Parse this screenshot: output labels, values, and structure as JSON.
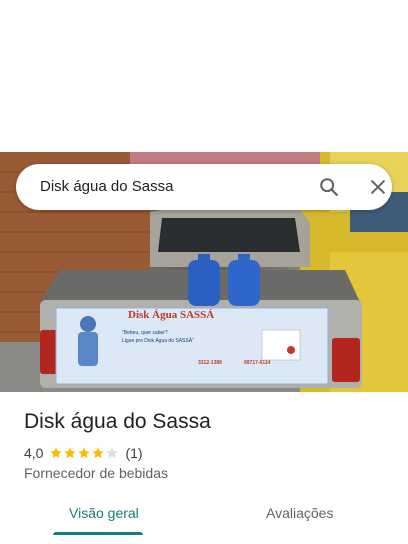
{
  "search": {
    "query": "Disk água do Sassa"
  },
  "photo": {
    "banner_title": "Disk Água SASSÁ",
    "banner_tagline_1": "\"Bebeu, quer saber?",
    "banner_tagline_2": "Ligue pro Disk Água do SASSÁ\"",
    "banner_phone_1": "3312-1389",
    "banner_phone_2": "99717-6114"
  },
  "place": {
    "title": "Disk água do Sassa",
    "rating": "4,0",
    "stars_filled": 4,
    "stars_total": 5,
    "review_count": "(1)",
    "category": "Fornecedor de bebidas"
  },
  "tabs": [
    {
      "label": "Visão geral",
      "active": true
    },
    {
      "label": "Avaliações",
      "active": false
    }
  ],
  "colors": {
    "accent": "#167c7e",
    "star": "#fbbc04",
    "star_empty": "#dadce0"
  }
}
